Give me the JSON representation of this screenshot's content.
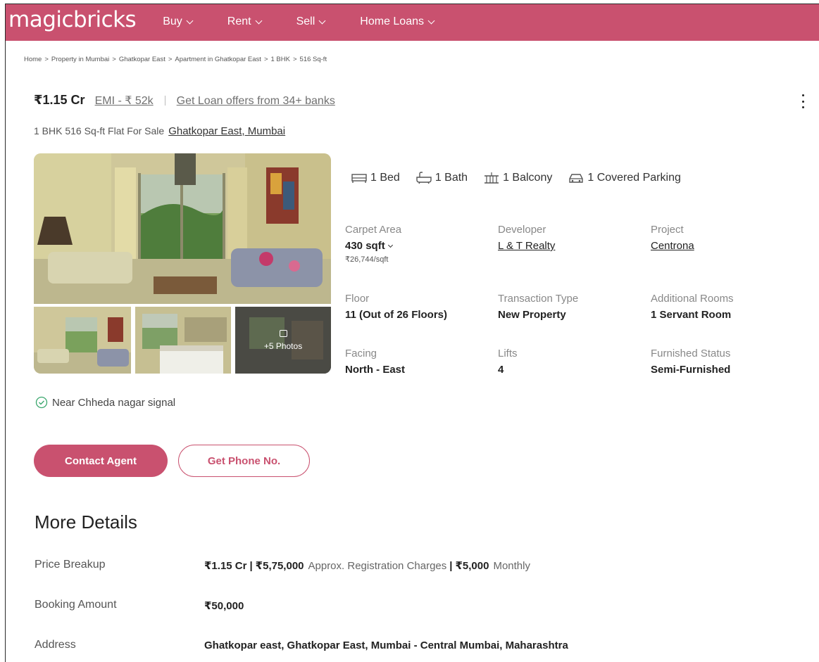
{
  "header": {
    "logo": "magicbricks",
    "nav": [
      "Buy",
      "Rent",
      "Sell",
      "Home Loans"
    ],
    "accent": "#c9516f"
  },
  "breadcrumb": [
    "Home",
    "Property in Mumbai",
    "Ghatkopar East",
    "Apartment in Ghatkopar East",
    "1 BHK",
    "516 Sq-ft"
  ],
  "listing": {
    "price": "₹1.15 Cr",
    "emi": "EMI - ₹ 52k",
    "loan_offer": "Get Loan offers from 34+ banks",
    "title": "1 BHK 516 Sq-ft Flat For Sale",
    "location": "Ghatkopar East, Mumbai",
    "more_photos": "+5 Photos"
  },
  "amenities": [
    {
      "icon": "bed-icon",
      "label": "1 Bed"
    },
    {
      "icon": "bath-icon",
      "label": "1 Bath"
    },
    {
      "icon": "balcony-icon",
      "label": "1 Balcony"
    },
    {
      "icon": "car-icon",
      "label": "1 Covered Parking"
    }
  ],
  "details": {
    "carpet_area": {
      "label": "Carpet Area",
      "value": "430 sqft",
      "sub": "₹26,744/sqft"
    },
    "developer": {
      "label": "Developer",
      "value": "L & T Realty"
    },
    "project": {
      "label": "Project",
      "value": "Centrona"
    },
    "floor": {
      "label": "Floor",
      "value": "11 (Out of 26 Floors)"
    },
    "transaction": {
      "label": "Transaction Type",
      "value": "New Property"
    },
    "additional": {
      "label": "Additional Rooms",
      "value": "1 Servant Room"
    },
    "facing": {
      "label": "Facing",
      "value": "North - East"
    },
    "lifts": {
      "label": "Lifts",
      "value": "4"
    },
    "furnished": {
      "label": "Furnished Status",
      "value": "Semi-Furnished"
    }
  },
  "near": "Near Chheda nagar signal",
  "buttons": {
    "contact": "Contact Agent",
    "phone": "Get Phone No."
  },
  "more_details": {
    "title": "More Details",
    "price_breakup_label": "Price Breakup",
    "price_breakup_price": "₹1.15 Cr",
    "sep": "|",
    "registration_amount": "₹5,75,000",
    "registration_text": "Approx. Registration Charges",
    "monthly_amount": "₹5,000",
    "monthly_text": "Monthly",
    "booking_label": "Booking Amount",
    "booking_value": "₹50,000",
    "address_label": "Address",
    "address_value": "Ghatkopar east, Ghatkopar East, Mumbai - Central Mumbai, Maharashtra"
  }
}
